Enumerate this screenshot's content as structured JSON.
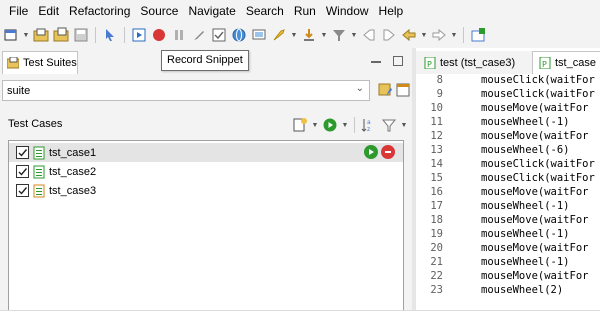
{
  "menu": [
    "File",
    "Edit",
    "Refactoring",
    "Source",
    "Navigate",
    "Search",
    "Run",
    "Window",
    "Help"
  ],
  "tooltip": "Record Snippet",
  "test_suites_view": {
    "title": "Test Suites",
    "suite_value": "suite"
  },
  "test_cases": {
    "label": "Test Cases",
    "items": [
      {
        "name": "tst_case1",
        "checked": true,
        "selected": true
      },
      {
        "name": "tst_case2",
        "checked": true,
        "selected": false
      },
      {
        "name": "tst_case3",
        "checked": true,
        "selected": false
      }
    ]
  },
  "editor": {
    "tabs": [
      "test (tst_case3)",
      "tst_case"
    ],
    "lines": [
      {
        "n": "8",
        "code": "mouseClick(waitFor"
      },
      {
        "n": "9",
        "code": "mouseClick(waitFor"
      },
      {
        "n": "10",
        "code": "mouseMove(waitFor"
      },
      {
        "n": "11",
        "code": "mouseWheel(-1)"
      },
      {
        "n": "12",
        "code": "mouseMove(waitFor"
      },
      {
        "n": "13",
        "code": "mouseWheel(-6)"
      },
      {
        "n": "14",
        "code": "mouseClick(waitFor"
      },
      {
        "n": "15",
        "code": "mouseClick(waitFor"
      },
      {
        "n": "16",
        "code": "mouseMove(waitFor"
      },
      {
        "n": "17",
        "code": "mouseWheel(-1)"
      },
      {
        "n": "18",
        "code": "mouseMove(waitFor"
      },
      {
        "n": "19",
        "code": "mouseWheel(-1)"
      },
      {
        "n": "20",
        "code": "mouseMove(waitFor"
      },
      {
        "n": "21",
        "code": "mouseWheel(-1)"
      },
      {
        "n": "22",
        "code": "mouseMove(waitFor"
      },
      {
        "n": "23",
        "code": "mouseWheel(2)"
      }
    ]
  },
  "colors": {
    "record": "#d93636",
    "run": "#2c9a2c",
    "chrome": "#f3f3f3",
    "selection": "#e4e4e4"
  }
}
